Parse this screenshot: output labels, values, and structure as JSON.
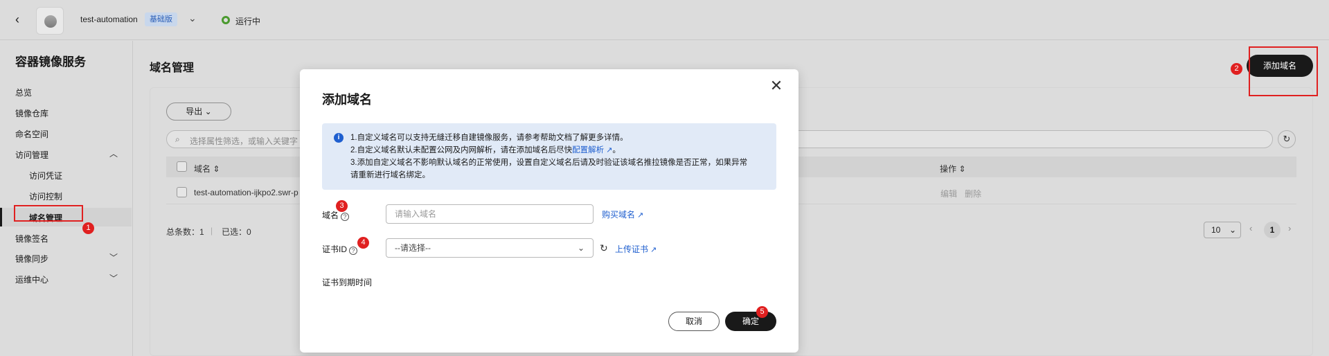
{
  "topbar": {
    "back_icon": "chevron-left-icon",
    "service_icon": "container-registry-icon",
    "instance_name": "test-automation",
    "tier_badge": "基础版",
    "status": "运行中",
    "status_color": "#4a9a2e"
  },
  "sidebar": {
    "title": "容器镜像服务",
    "items": [
      {
        "label": "总览"
      },
      {
        "label": "镜像仓库"
      },
      {
        "label": "命名空间"
      },
      {
        "label": "访问管理",
        "expanded": true
      },
      {
        "label": "访问凭证"
      },
      {
        "label": "访问控制"
      },
      {
        "label": "域名管理",
        "active": true
      },
      {
        "label": "镜像签名"
      },
      {
        "label": "镜像同步",
        "expanded": false
      },
      {
        "label": "运维中心",
        "expanded": false
      }
    ]
  },
  "main": {
    "page_title": "域名管理",
    "add_domain_button": "添加域名",
    "export_button": "导出",
    "search_placeholder": "选择属性筛选，或输入关键字",
    "table": {
      "columns": [
        "域名",
        "操作"
      ],
      "rows": [
        {
          "domain": "test-automation-ijkpo2.swr-p",
          "actions": [
            "编辑",
            "删除"
          ]
        }
      ]
    },
    "footer": {
      "total_label": "总条数：1",
      "selected_label": "已选：0",
      "page_size": "10",
      "current_page": "1"
    }
  },
  "modal": {
    "title": "添加域名",
    "info_lines": [
      "1.自定义域名可以支持无缝迁移自建镜像服务，请参考帮助文档了解更多详情。",
      "2.自定义域名默认未配置公网及内网解析，请在添加域名后尽快",
      "3.添加自定义域名不影响默认域名的正常使用，设置自定义域名后请及时验证该域名推拉镜像是否正常，如果异常",
      "请重新进行域名绑定。"
    ],
    "info_link": "配置解析",
    "info_tail": "。",
    "domain_label": "域名",
    "domain_placeholder": "请输入域名",
    "buy_domain_link": "购买域名",
    "cert_label": "证书ID",
    "cert_placeholder": "--请选择--",
    "upload_cert_link": "上传证书",
    "expiry_label": "证书到期时间",
    "cancel_button": "取消",
    "ok_button": "确定"
  },
  "annotations": {
    "markers": [
      "1",
      "2",
      "3",
      "4",
      "5"
    ],
    "color": "#e02020"
  }
}
